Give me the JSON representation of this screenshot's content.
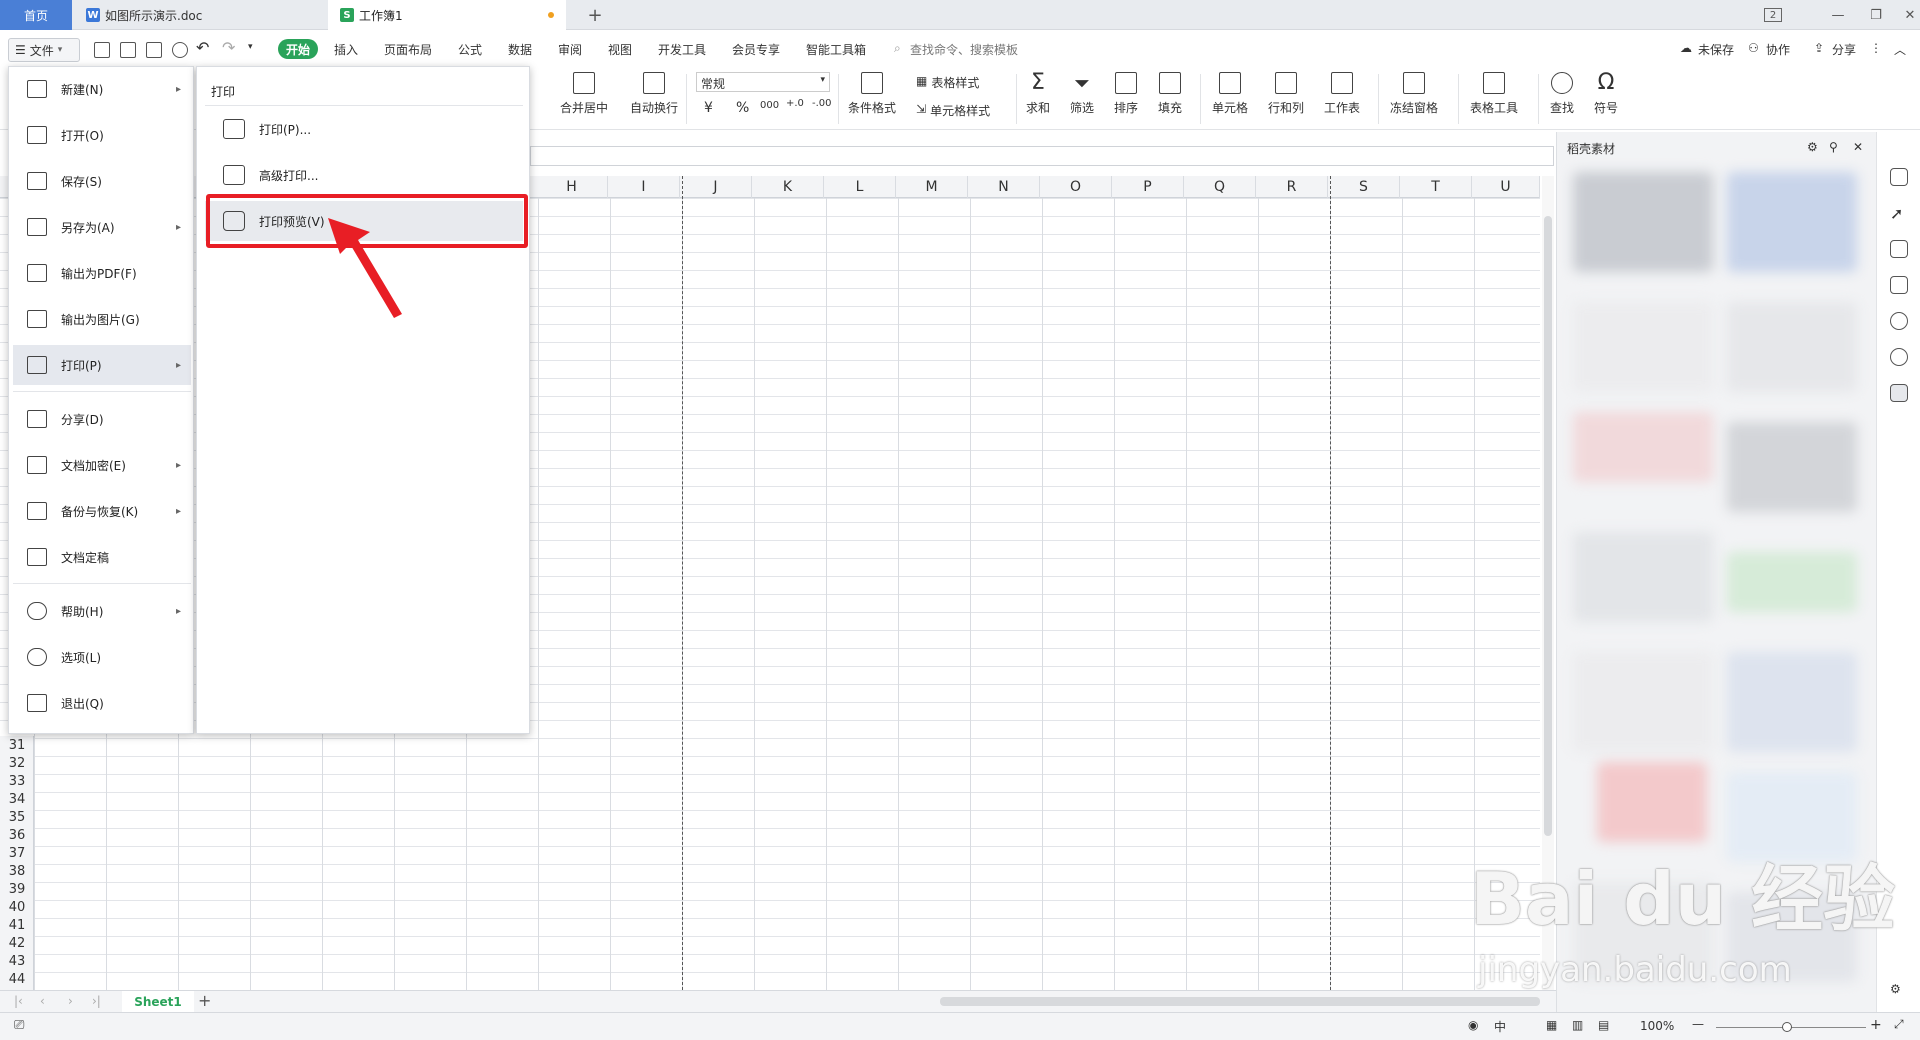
{
  "tabs": {
    "home": "首页",
    "doc": "如图所示演示.doc",
    "workbook": "工作簿1",
    "add": "+",
    "window_badge": "2"
  },
  "menu": {
    "file": "文件",
    "items": [
      "开始",
      "插入",
      "页面布局",
      "公式",
      "数据",
      "审阅",
      "视图",
      "开发工具",
      "会员专享",
      "智能工具箱"
    ],
    "search_placeholder": "查找命令、搜索模板",
    "unsaved": "未保存",
    "collab": "协作",
    "share": "分享"
  },
  "ribbon": {
    "merge": "合并居中",
    "wrap": "自动换行",
    "number_format": "常规",
    "cond_format": "条件格式",
    "table_style": "表格样式",
    "cell_style": "单元格样式",
    "sum": "求和",
    "filter": "筛选",
    "sort": "排序",
    "fill": "填充",
    "cell": "单元格",
    "rowcol": "行和列",
    "sheet": "工作表",
    "freeze": "冻结窗格",
    "tools": "表格工具",
    "find": "查找",
    "symbol": "符号",
    "currency": "¥",
    "percent": "%",
    "thousands": "000"
  },
  "columns": [
    "H",
    "I",
    "J",
    "K",
    "L",
    "M",
    "N",
    "O",
    "P",
    "Q",
    "R",
    "S",
    "T",
    "U"
  ],
  "rows": [
    "31",
    "32",
    "33",
    "34",
    "35",
    "36",
    "37",
    "38",
    "39",
    "40",
    "41",
    "42",
    "43",
    "44"
  ],
  "file_menu": {
    "new": "新建(N)",
    "open": "打开(O)",
    "save": "保存(S)",
    "save_as": "另存为(A)",
    "export_pdf": "输出为PDF(F)",
    "export_img": "输出为图片(G)",
    "print": "打印(P)",
    "share": "分享(D)",
    "encrypt": "文档加密(E)",
    "backup": "备份与恢复(K)",
    "finalize": "文档定稿",
    "help": "帮助(H)",
    "options": "选项(L)",
    "exit": "退出(Q)"
  },
  "submenu": {
    "title": "打印",
    "print": "打印(P)...",
    "advanced": "高级打印...",
    "preview": "打印预览(V)"
  },
  "right_pane": {
    "title": "稻壳素材"
  },
  "sheet": {
    "name": "Sheet1",
    "add": "+"
  },
  "status": {
    "zoom": "100%",
    "lang": "中"
  },
  "watermark": {
    "brand": "Bai du 经验",
    "url": "jingyan.baidu.com"
  },
  "colors": {
    "accent_green": "#2aa35a",
    "home_tab": "#4a7fd6",
    "highlight_red": "#e81e25"
  }
}
